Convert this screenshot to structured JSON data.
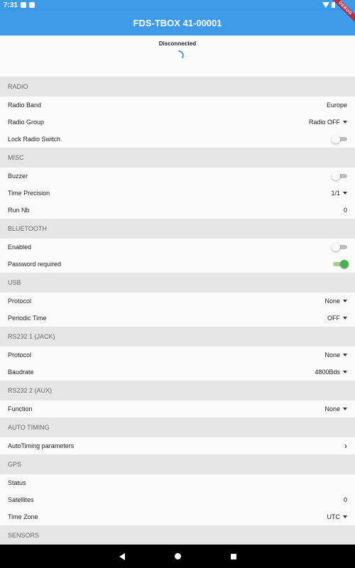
{
  "status_bar": {
    "time": "7:31"
  },
  "app_bar": {
    "title": "FDS-TBOX 41-00001",
    "ribbon": "DEBUG"
  },
  "connection": {
    "status": "Disconnected"
  },
  "colors": {
    "accent": "#3e9be9",
    "toggle_on": "#4caf50",
    "section_bg": "#e5e5e5"
  },
  "sections": {
    "radio": {
      "header": "RADIO",
      "band_label": "Radio Band",
      "band_value": "Europe",
      "group_label": "Radio Group",
      "group_value": "Radio OFF",
      "lock_label": "Lock Radio Switch",
      "lock_on": false
    },
    "misc": {
      "header": "MISC",
      "buzzer_label": "Buzzer",
      "buzzer_on": false,
      "precision_label": "Time Precision",
      "precision_value": "1/1",
      "run_label": "Run Nb",
      "run_value": "0"
    },
    "bluetooth": {
      "header": "BLUETOOTH",
      "enabled_label": "Enabled",
      "enabled_on": false,
      "password_label": "Password required",
      "password_on": true
    },
    "usb": {
      "header": "USB",
      "protocol_label": "Protocol",
      "protocol_value": "None",
      "periodic_label": "Periodic Time",
      "periodic_value": "OFF"
    },
    "rs232_1": {
      "header": "RS232 1 (JACK)",
      "protocol_label": "Protocol",
      "protocol_value": "None",
      "baud_label": "Baudrate",
      "baud_value": "4800Bds"
    },
    "rs232_2": {
      "header": "RS232 2 (AUX)",
      "function_label": "Function",
      "function_value": "None"
    },
    "auto_timing": {
      "header": "AUTO TIMING",
      "params_label": "AutoTiming parameters"
    },
    "gps": {
      "header": "GPS",
      "status_label": "Status",
      "status_value": "",
      "satellites_label": "Satellites",
      "satellites_value": "0",
      "timezone_label": "Time Zone",
      "timezone_value": "UTC"
    },
    "next": {
      "header": "SENSORS"
    }
  }
}
